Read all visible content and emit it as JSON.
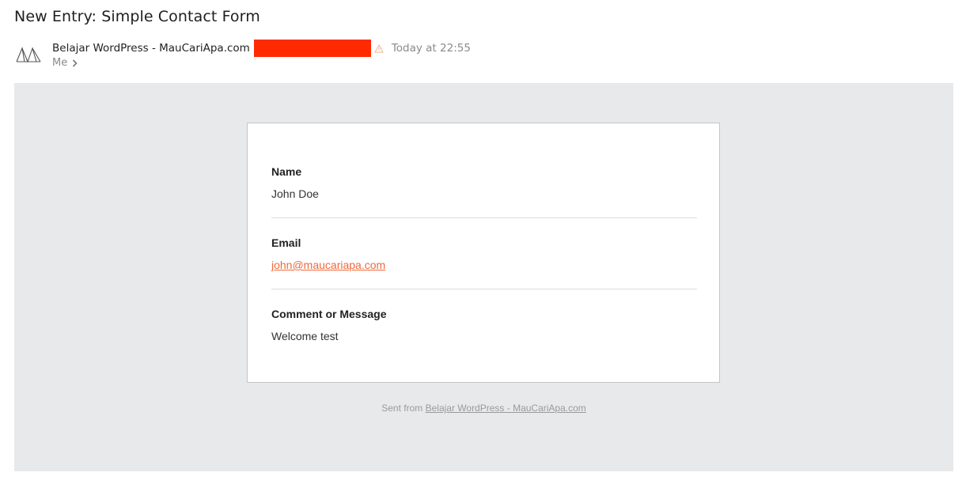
{
  "email": {
    "subject": "New Entry: Simple Contact Form",
    "sender_name": "Belajar WordPress - MauCariApa.com",
    "date": "Today at 22:55",
    "recipient": "Me",
    "avatar_icon": "site-logo-icon",
    "colors": {
      "redaction": "#ff2a00",
      "link": "#f0683a",
      "body_bg": "#e8e9eb"
    }
  },
  "form": {
    "fields": [
      {
        "label": "Name",
        "value": "John Doe"
      },
      {
        "label": "Email",
        "value": "john@maucariapa.com"
      },
      {
        "label": "Comment or Message",
        "value": "Welcome test"
      }
    ]
  },
  "footer": {
    "prefix": "Sent from",
    "link_text": "Belajar WordPress - MauCariApa.com"
  }
}
